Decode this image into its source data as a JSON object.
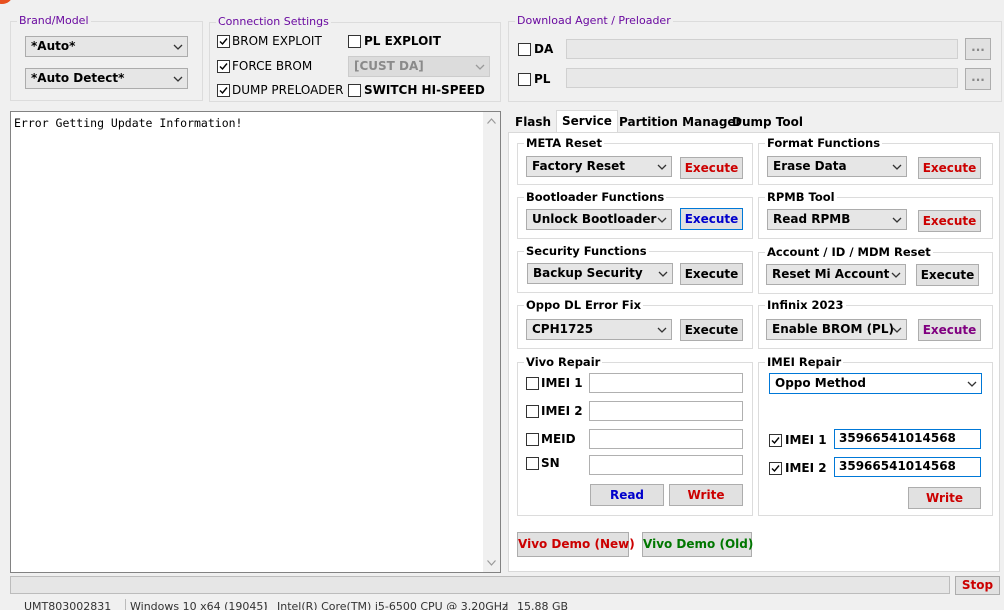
{
  "brand_model": {
    "title": "Brand/Model",
    "brand_value": "*Auto*",
    "model_value": "*Auto Detect*"
  },
  "connection": {
    "title": "Connection Settings",
    "brom_exploit": "BROM EXPLOIT",
    "force_brom": "FORCE BROM",
    "dump_preloader": "DUMP PRELOADER",
    "pl_exploit": "PL EXPLOIT",
    "cust_da": "[CUST DA]",
    "switch_hispeed": "SWITCH HI-SPEED"
  },
  "download_agent": {
    "title": "Download Agent / Preloader",
    "da_label": "DA",
    "pl_label": "PL",
    "browse": "..."
  },
  "log": {
    "text": "Error Getting Update Information!"
  },
  "tabs": [
    "Flash",
    "Service",
    "Partition Manager",
    "Dump Tool"
  ],
  "service": {
    "meta_reset": {
      "title": "META Reset",
      "value": "Factory Reset",
      "button": "Execute"
    },
    "format": {
      "title": "Format Functions",
      "value": "Erase Data",
      "button": "Execute"
    },
    "bootloader": {
      "title": "Bootloader Functions",
      "value": "Unlock Bootloader",
      "button": "Execute"
    },
    "rpmb": {
      "title": "RPMB Tool",
      "value": "Read RPMB",
      "button": "Execute"
    },
    "security": {
      "title": "Security Functions",
      "value": "Backup Security",
      "button": "Execute"
    },
    "account": {
      "title": "Account / ID / MDM Reset",
      "value": "Reset Mi Account",
      "button": "Execute"
    },
    "oppo_dl": {
      "title": "Oppo DL Error Fix",
      "value": "CPH1725",
      "button": "Execute"
    },
    "infinix": {
      "title": "Infinix 2023",
      "value": "Enable BROM (PL)",
      "button": "Execute"
    },
    "vivo_repair": {
      "title": "Vivo Repair",
      "imei1": "IMEI 1",
      "imei2": "IMEI 2",
      "meid": "MEID",
      "sn": "SN",
      "read": "Read",
      "write": "Write"
    },
    "imei_repair": {
      "title": "IMEI Repair",
      "method": "Oppo Method",
      "imei1_label": "IMEI 1",
      "imei1_value": "35966541014568",
      "imei2_label": "IMEI 2",
      "imei2_value": "35966541014568",
      "write": "Write"
    },
    "vivo_demo_new": "Vivo Demo (New)",
    "vivo_demo_old": "Vivo Demo (Old)"
  },
  "stop_button": "Stop",
  "status": {
    "serial": "UMT803002831",
    "os": "Windows 10 x64 (19045)",
    "cpu": "Intel(R) Core(TM) i5-6500 CPU @ 3.20GHz",
    "ram": "15.88 GB"
  },
  "colors": {
    "red": "#cc0000",
    "blue": "#0000cc",
    "purple": "#800080",
    "green": "#007700",
    "group_title": "#6a0aa0"
  }
}
